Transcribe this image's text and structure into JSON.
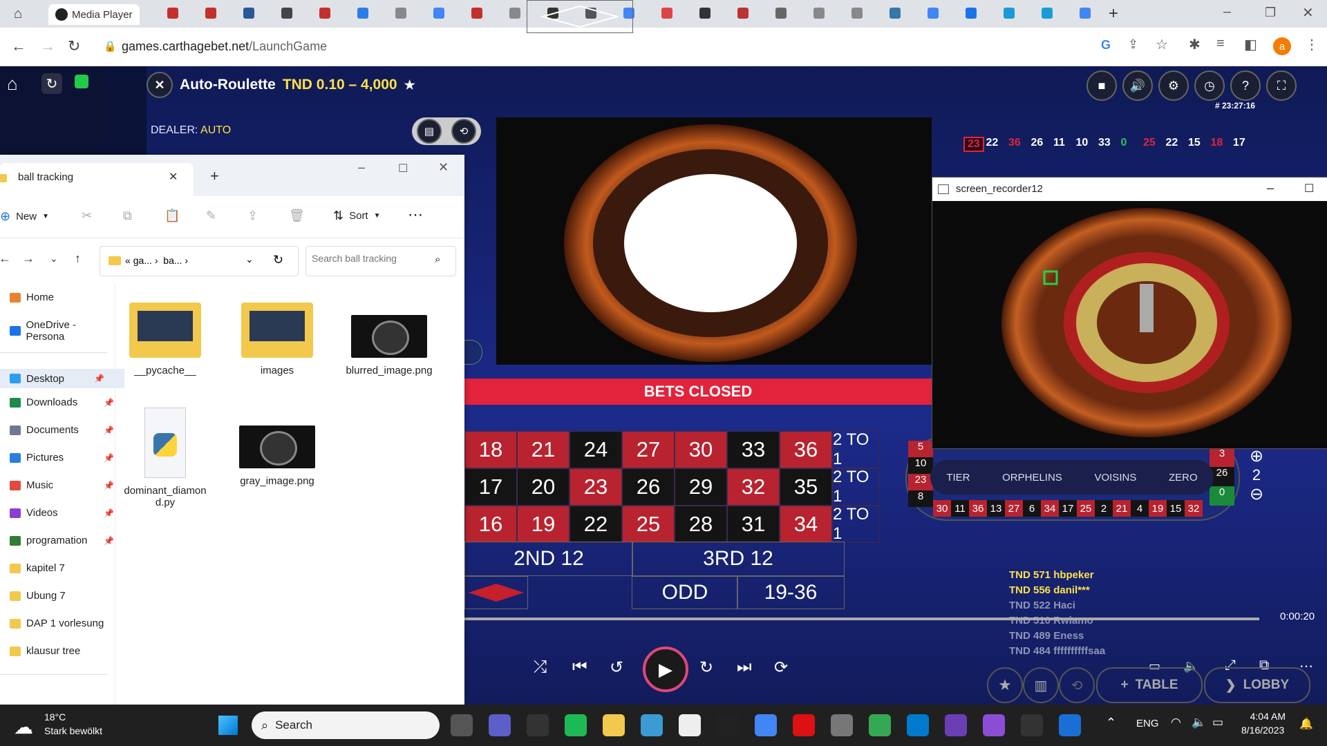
{
  "browser": {
    "active_tab_title": "Media Player",
    "url_domain": "games.carthagebet.net",
    "url_path": "/LaunchGame"
  },
  "game": {
    "title": "Auto-Roulette",
    "limits": "TND 0.10 – 4,000",
    "dealer_label": "DEALER:",
    "dealer_value": "AUTO",
    "time": "# 23:27:16",
    "status": "BETS CLOSED",
    "last_numbers": [
      "23",
      "22",
      "36",
      "26",
      "11",
      "10",
      "33",
      "0",
      "25",
      "22",
      "15",
      "18",
      "17"
    ],
    "last_numbers_colors": [
      "#e3223b",
      "#fff",
      "#e3223b",
      "#fff",
      "#fff",
      "#fff",
      "#fff",
      "#2fbf5a",
      "#e3223b",
      "#fff",
      "#fff",
      "#e3223b",
      "#fff"
    ],
    "table_rows": [
      {
        "cells": [
          "18",
          "21",
          "24",
          "27",
          "30",
          "33",
          "36"
        ],
        "colors": [
          "red",
          "red",
          "blk",
          "red",
          "red",
          "blk",
          "red"
        ],
        "col": "2 TO 1"
      },
      {
        "cells": [
          "17",
          "20",
          "23",
          "26",
          "29",
          "32",
          "35"
        ],
        "colors": [
          "blk",
          "blk",
          "red",
          "blk",
          "blk",
          "red",
          "blk"
        ],
        "col": "2 TO 1"
      },
      {
        "cells": [
          "16",
          "19",
          "22",
          "25",
          "28",
          "31",
          "34"
        ],
        "colors": [
          "red",
          "red",
          "blk",
          "red",
          "blk",
          "blk",
          "red"
        ],
        "col": "2 TO 1"
      }
    ],
    "dozen_2": "2ND 12",
    "dozen_3": "3RD 12",
    "odd": "ODD",
    "high": "19-36",
    "racetrack": {
      "sections": [
        "TIER",
        "ORPHELINS",
        "VOISINS",
        "ZERO"
      ],
      "bottom_numbers": [
        "30",
        "11",
        "36",
        "13",
        "27",
        "6",
        "34",
        "17",
        "25",
        "2",
        "21",
        "4",
        "19",
        "15",
        "32"
      ],
      "left_numbers": [
        "5",
        "10",
        "23",
        "8"
      ],
      "right_numbers": [
        "3",
        "26",
        "0"
      ],
      "neighbours": "2"
    },
    "chat": [
      {
        "text": "TND 571 hbpeker",
        "color": "#ffe14a"
      },
      {
        "text": "TND 556 danil***",
        "color": "#ffe14a"
      },
      {
        "text": "TND 522 Haci",
        "color": "#8f95b8"
      },
      {
        "text": "TND 510 Rwiamo",
        "color": "#8f95b8"
      },
      {
        "text": "TND 489 Eness",
        "color": "#8f95b8"
      },
      {
        "text": "TND 484 ffffffffffsaa",
        "color": "#8f95b8"
      }
    ],
    "table_btn": "TABLE",
    "lobby_btn": "LOBBY"
  },
  "explorer": {
    "tab_title": "ball tracking",
    "new_label": "New",
    "sort_label": "Sort",
    "breadcrumb": [
      "ga...",
      "ba..."
    ],
    "search_placeholder": "Search ball tracking",
    "sidebar": [
      {
        "label": "Home",
        "pinned": false,
        "color": "#e8822d"
      },
      {
        "label": "OneDrive - Persona",
        "pinned": false,
        "color": "#1a73e8"
      },
      {
        "label": "Desktop",
        "pinned": true,
        "color": "#2a9df4"
      },
      {
        "label": "Downloads",
        "pinned": true,
        "color": "#1c8a4a"
      },
      {
        "label": "Documents",
        "pinned": true,
        "color": "#6e7891"
      },
      {
        "label": "Pictures",
        "pinned": true,
        "color": "#2a7de1"
      },
      {
        "label": "Music",
        "pinned": true,
        "color": "#e24a3b"
      },
      {
        "label": "Videos",
        "pinned": true,
        "color": "#8b3fd1"
      },
      {
        "label": "programation",
        "pinned": true,
        "color": "#2e7d32"
      },
      {
        "label": "kapitel 7",
        "pinned": false,
        "color": "#f2c94c"
      },
      {
        "label": "Ubung 7",
        "pinned": false,
        "color": "#f2c94c"
      },
      {
        "label": "DAP 1 vorlesung",
        "pinned": false,
        "color": "#f2c94c"
      },
      {
        "label": "klausur tree",
        "pinned": false,
        "color": "#f2c94c"
      }
    ],
    "files": [
      {
        "name": "__pycache__",
        "type": "folder"
      },
      {
        "name": "images",
        "type": "folder"
      },
      {
        "name": "blurred_image.png",
        "type": "image"
      },
      {
        "name": "dominant_diamond.py",
        "type": "python"
      },
      {
        "name": "gray_image.png",
        "type": "image"
      }
    ]
  },
  "recorder": {
    "title": "screen_recorder12"
  },
  "player": {
    "time": "0:00:20"
  },
  "taskbar": {
    "weather_temp": "18°C",
    "weather_desc": "Stark bewölkt",
    "search_label": "Search",
    "language": "ENG",
    "clock_time": "4:04 AM",
    "clock_date": "8/16/2023"
  }
}
